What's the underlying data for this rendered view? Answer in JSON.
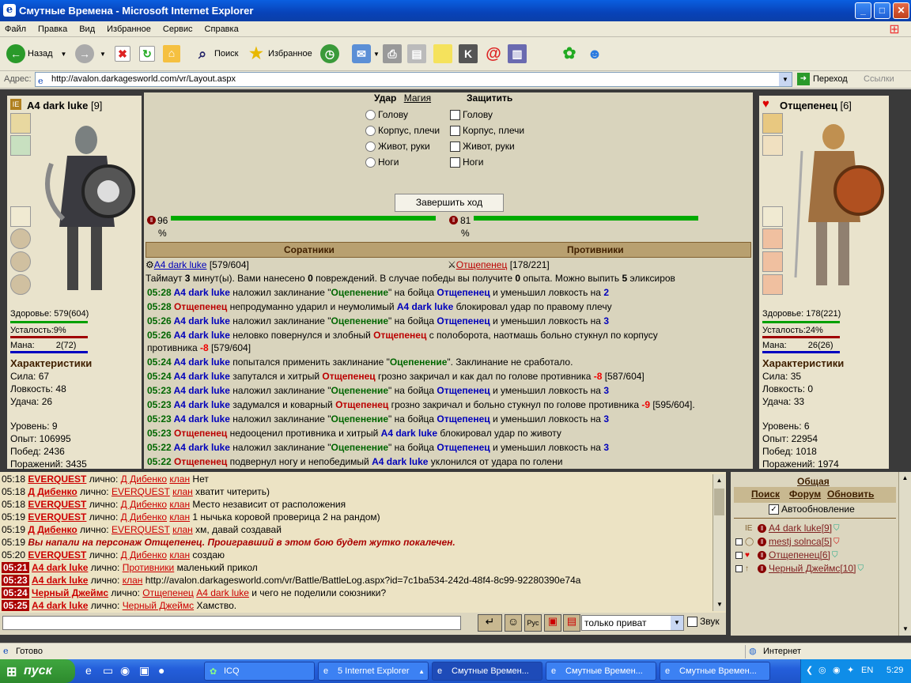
{
  "window": {
    "title": "Смутные Времена - Microsoft Internet Explorer"
  },
  "menu": [
    "Файл",
    "Правка",
    "Вид",
    "Избранное",
    "Сервис",
    "Справка"
  ],
  "toolbar": {
    "back": "Назад",
    "search": "Поиск",
    "favorites": "Избранное"
  },
  "address": {
    "label": "Адрес:",
    "url": "http://avalon.darkagesworld.com/vr/Layout.aspx",
    "go": "Переход",
    "links": "Ссылки"
  },
  "left_char": {
    "name": "A4 dark luke",
    "level": "[9]",
    "health_label": "Здоровье:",
    "health": "579(604)",
    "fatigue_label": "Усталость:",
    "fatigue": "9%",
    "mana_label": "Мана:",
    "mana": "2(72)",
    "stats_title": "Характеристики",
    "str": "Сила: 67",
    "agi": "Ловкость: 48",
    "luck": "Удача: 26",
    "lvl": "Уровень: 9",
    "exp": "Опыт: 106995",
    "wins": "Побед: 2436",
    "losses": "Поражений: 3435"
  },
  "right_char": {
    "name": "Отщепенец",
    "level": "[6]",
    "health_label": "Здоровье:",
    "health": "178(221)",
    "fatigue_label": "Усталость:",
    "fatigue": "24%",
    "mana_label": "Мана:",
    "mana": "26(26)",
    "stats_title": "Характеристики",
    "str": "Сила: 35",
    "agi": "Ловкость: 0",
    "luck": "Удача: 33",
    "lvl": "Уровень: 6",
    "exp": "Опыт: 22954",
    "wins": "Побед: 1018",
    "losses": "Поражений: 1974"
  },
  "battle": {
    "attack": "Удар",
    "magic": "Магия",
    "defend": "Защитить",
    "zones": [
      "Голову",
      "Корпус, плечи",
      "Живот, руки",
      "Ноги"
    ],
    "end_turn": "Завершить ход",
    "hp_left": "96",
    "hp_right": "81",
    "pct": "%",
    "allies": "Соратники",
    "enemies": "Противники",
    "ally": "A4 dark luke",
    "ally_hp": "[579/604]",
    "enemy": "Отщепенец",
    "enemy_hp": "[178/221]",
    "timeout": {
      "a": "Таймаут ",
      "b": "3",
      "c": " минут(ы). Вами нанесено ",
      "d": "0",
      "e": " повреждений. В случае победы вы получите ",
      "f": "0",
      "g": " опыта. Можно выпить ",
      "h": "5",
      "i": " эликсиров"
    }
  },
  "log": [
    {
      "t": "05:28",
      "parts": [
        [
          "b",
          "A4 dark luke"
        ],
        [
          "n",
          " наложил заклинание \""
        ],
        [
          "g",
          "Оцепенение"
        ],
        [
          "n",
          "\" на бойца "
        ],
        [
          "b",
          "Отщепенец"
        ],
        [
          "n",
          " и уменьшил ловкость на "
        ],
        [
          "b",
          "2"
        ]
      ]
    },
    {
      "t": "05:28",
      "parts": [
        [
          "r",
          "Отщепенец"
        ],
        [
          "n",
          " непродуманно ударил и неумолимый "
        ],
        [
          "b",
          "A4 dark luke"
        ],
        [
          "n",
          " блокировал удар по правому плечу"
        ]
      ]
    },
    {
      "t": "05:26",
      "parts": [
        [
          "b",
          "A4 dark luke"
        ],
        [
          "n",
          " наложил заклинание \""
        ],
        [
          "g",
          "Оцепенение"
        ],
        [
          "n",
          "\" на бойца "
        ],
        [
          "b",
          "Отщепенец"
        ],
        [
          "n",
          " и уменьшил ловкость на "
        ],
        [
          "b",
          "3"
        ]
      ]
    },
    {
      "t": "05:26",
      "parts": [
        [
          "b",
          "A4 dark luke"
        ],
        [
          "n",
          " неловко повернулся и злобный "
        ],
        [
          "r",
          "Отщепенец"
        ],
        [
          "n",
          " с полоборота, наотмашь больно стукнул по корпусу"
        ]
      ]
    },
    {
      "t": "",
      "parts": [
        [
          "n",
          "противника "
        ],
        [
          "rn",
          "-8"
        ],
        [
          "n",
          " [579/604]"
        ]
      ]
    },
    {
      "t": "05:24",
      "parts": [
        [
          "b",
          "A4 dark luke"
        ],
        [
          "n",
          " попытался применить заклинание \""
        ],
        [
          "g",
          "Оцепенение"
        ],
        [
          "n",
          "\". Заклинание не сработало."
        ]
      ]
    },
    {
      "t": "05:24",
      "parts": [
        [
          "b",
          "A4 dark luke"
        ],
        [
          "n",
          " запутался и хитрый "
        ],
        [
          "r",
          "Отщепенец"
        ],
        [
          "n",
          " грозно закричал и как дал по голове противника "
        ],
        [
          "rn",
          "-8"
        ],
        [
          "n",
          " [587/604]"
        ]
      ]
    },
    {
      "t": "05:23",
      "parts": [
        [
          "b",
          "A4 dark luke"
        ],
        [
          "n",
          " наложил заклинание \""
        ],
        [
          "g",
          "Оцепенение"
        ],
        [
          "n",
          "\" на бойца "
        ],
        [
          "b",
          "Отщепенец"
        ],
        [
          "n",
          " и уменьшил ловкость на "
        ],
        [
          "b",
          "3"
        ]
      ]
    },
    {
      "t": "05:23",
      "parts": [
        [
          "b",
          "A4 dark luke"
        ],
        [
          "n",
          " задумался и коварный "
        ],
        [
          "r",
          "Отщепенец"
        ],
        [
          "n",
          " грозно закричал и больно стукнул по голове противника "
        ],
        [
          "rn",
          "-9"
        ],
        [
          "n",
          " [595/604]."
        ]
      ]
    },
    {
      "t": "05:23",
      "parts": [
        [
          "b",
          "A4 dark luke"
        ],
        [
          "n",
          " наложил заклинание \""
        ],
        [
          "g",
          "Оцепенение"
        ],
        [
          "n",
          "\" на бойца "
        ],
        [
          "b",
          "Отщепенец"
        ],
        [
          "n",
          " и уменьшил ловкость на "
        ],
        [
          "b",
          "3"
        ]
      ]
    },
    {
      "t": "05:23",
      "parts": [
        [
          "r",
          "Отщепенец"
        ],
        [
          "n",
          " недооценил противника и хитрый "
        ],
        [
          "b",
          "A4 dark luke"
        ],
        [
          "n",
          " блокировал удар по животу"
        ]
      ]
    },
    {
      "t": "05:22",
      "parts": [
        [
          "b",
          "A4 dark luke"
        ],
        [
          "n",
          " наложил заклинание \""
        ],
        [
          "g",
          "Оцепенение"
        ],
        [
          "n",
          "\" на бойца "
        ],
        [
          "b",
          "Отщепенец"
        ],
        [
          "n",
          " и уменьшил ловкость на "
        ],
        [
          "b",
          "3"
        ]
      ]
    },
    {
      "t": "05:22",
      "parts": [
        [
          "r",
          "Отщепенец"
        ],
        [
          "n",
          " подвернул ногу и непобедимый "
        ],
        [
          "b",
          "A4 dark luke"
        ],
        [
          "n",
          " уклонился от удара по голени"
        ]
      ]
    }
  ],
  "chat": [
    {
      "t": "05:18",
      "hl": false,
      "parts": [
        [
          "nm",
          "EVERQUEST"
        ],
        [
          "l",
          " лично: "
        ],
        [
          "nmn",
          "Д Дибенко"
        ],
        [
          "l",
          " "
        ],
        [
          "nmn",
          "клан"
        ],
        [
          "l",
          " Нет"
        ]
      ]
    },
    {
      "t": "05:18",
      "hl": false,
      "parts": [
        [
          "nm",
          "Д Дибенко"
        ],
        [
          "l",
          " лично: "
        ],
        [
          "nmn",
          "EVERQUEST"
        ],
        [
          "l",
          " "
        ],
        [
          "nmn",
          "клан"
        ],
        [
          "l",
          " хватит читерить)"
        ]
      ]
    },
    {
      "t": "05:18",
      "hl": false,
      "parts": [
        [
          "nm",
          "EVERQUEST"
        ],
        [
          "l",
          " лично: "
        ],
        [
          "nmn",
          "Д Дибенко"
        ],
        [
          "l",
          " "
        ],
        [
          "nmn",
          "клан"
        ],
        [
          "l",
          " Место независит от расположения"
        ]
      ]
    },
    {
      "t": "05:19",
      "hl": false,
      "parts": [
        [
          "nm",
          "EVERQUEST"
        ],
        [
          "l",
          " лично: "
        ],
        [
          "nmn",
          "Д Дибенко"
        ],
        [
          "l",
          " "
        ],
        [
          "nmn",
          "клан"
        ],
        [
          "l",
          " 1 нычька коровой проверица 2 на рандом)"
        ]
      ]
    },
    {
      "t": "05:19",
      "hl": false,
      "parts": [
        [
          "nm",
          "Д Дибенко"
        ],
        [
          "l",
          " лично: "
        ],
        [
          "nmn",
          "EVERQUEST"
        ],
        [
          "l",
          " "
        ],
        [
          "nmn",
          "клан"
        ],
        [
          "l",
          " хм, давай создавай"
        ]
      ]
    },
    {
      "t": "05:19",
      "hl": false,
      "parts": [
        [
          "sys",
          "Вы напали на персонаж Отщепенец. Проигравший в этом бою будет жутко покалечен."
        ]
      ]
    },
    {
      "t": "05:20",
      "hl": false,
      "parts": [
        [
          "nm",
          "EVERQUEST"
        ],
        [
          "l",
          " лично: "
        ],
        [
          "nmn",
          "Д Дибенко"
        ],
        [
          "l",
          " "
        ],
        [
          "nmn",
          "клан"
        ],
        [
          "l",
          " создаю"
        ]
      ]
    },
    {
      "t": "05:21",
      "hl": true,
      "parts": [
        [
          "nm",
          "A4 dark luke"
        ],
        [
          "l",
          " лично: "
        ],
        [
          "nmn",
          "Противники"
        ],
        [
          "l",
          " маленький прикол"
        ]
      ]
    },
    {
      "t": "05:23",
      "hl": true,
      "parts": [
        [
          "nm",
          "A4 dark luke"
        ],
        [
          "l",
          " лично: "
        ],
        [
          "nmn",
          "клан"
        ],
        [
          "l",
          " http://avalon.darkagesworld.com/vr/Battle/BattleLog.aspx?id=7c1ba534-242d-48f4-8c99-92280390e74a"
        ]
      ]
    },
    {
      "t": "05:24",
      "hl": true,
      "parts": [
        [
          "nm",
          "Черный Джеймс"
        ],
        [
          "l",
          " лично: "
        ],
        [
          "nmn",
          "Отщепенец"
        ],
        [
          "l",
          " "
        ],
        [
          "nmn",
          "A4 dark luke"
        ],
        [
          "l",
          " и чего не поделили союзники?"
        ]
      ]
    },
    {
      "t": "05:25",
      "hl": true,
      "parts": [
        [
          "nm",
          "A4 dark luke"
        ],
        [
          "l",
          " лично: "
        ],
        [
          "nmn",
          "Черный Джеймс"
        ],
        [
          "l",
          " Хамство."
        ]
      ]
    }
  ],
  "chat_controls": {
    "select": "только приват",
    "sound": "Звук"
  },
  "online": {
    "tab": "Общая",
    "search": "Поиск",
    "forum": "Форум",
    "refresh": "Обновить",
    "autorefresh": "Автообновление",
    "users": [
      "A4 dark luke[9]",
      "mestj solnca[5]",
      "Отщепенец[6]",
      "Черный Джеймс[10]"
    ]
  },
  "status": {
    "ready": "Готово",
    "zone": "Интернет"
  },
  "taskbar": {
    "start": "пуск",
    "icq": "ICQ",
    "ie": "5 Internet Explorer",
    "t1": "Смутные Времен...",
    "t2": "Смутные Времен...",
    "t3": "Смутные Времен...",
    "lang": "EN",
    "clock": "5:29"
  },
  "colors": {
    "health": "#00a000",
    "fatigue": "#a00000",
    "mana": "#0000c0"
  }
}
